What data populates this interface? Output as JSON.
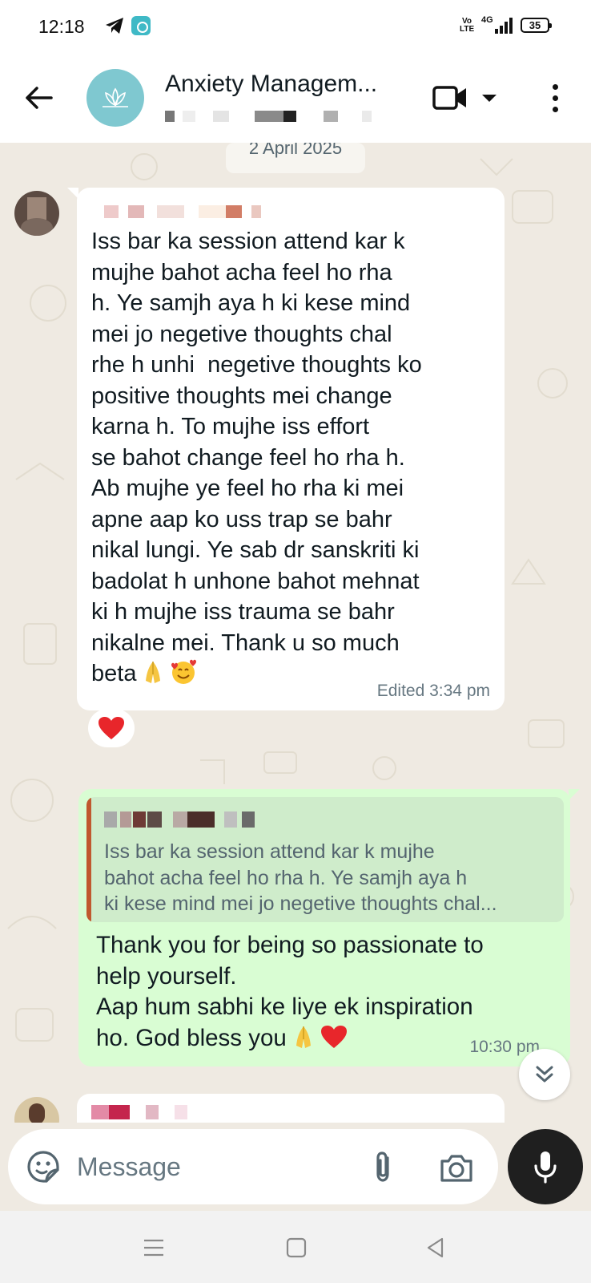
{
  "status_bar": {
    "time": "12:18",
    "volte": "Vo\nLTE",
    "network": "4G",
    "battery": "35",
    "icons": [
      "telegram-icon",
      "app-badge-icon",
      "signal-icon",
      "battery-icon"
    ]
  },
  "header": {
    "title": "Anxiety Managem...",
    "icons": [
      "back-arrow-icon",
      "video-call-icon",
      "chevron-down-icon",
      "more-vert-icon"
    ]
  },
  "chat": {
    "date_chip": "2 April 2025",
    "incoming": {
      "text": "Iss bar ka session attend kar k\nmujhe bahot acha feel ho rha\nh. Ye samjh aya h ki kese mind\nmei jo negetive thoughts chal\nrhe h unhi  negetive thoughts ko\npositive thoughts mei change\nkarna h. To mujhe iss effort\nse bahot change feel ho rha h.\nAb mujhe ye feel ho rha ki mei\napne aap ko uss trap se bahr\nnikal lungi. Ye sab dr sanskriti ki\nbadolat h unhone bahot mehnat\nki h mujhe iss trauma se bahr\nnikalne mei. Thank u so much\nbeta",
      "emojis": [
        "folded-hands-emoji",
        "smiling-face-with-hearts-emoji"
      ],
      "meta": "Edited 3:34 pm",
      "reaction": "red-heart-emoji"
    },
    "outgoing": {
      "quote_lines": [
        "Iss bar ka session attend kar k mujhe",
        "bahot acha feel ho rha h. Ye samjh aya h",
        "ki kese mind mei jo negetive thoughts chal..."
      ],
      "text": "Thank you for being so passionate to\nhelp yourself.\nAap hum sabhi ke liye ek inspiration\nho. God bless you",
      "emojis": [
        "folded-hands-emoji",
        "red-heart-emoji"
      ],
      "meta": "10:30 pm"
    }
  },
  "composer": {
    "placeholder": "Message",
    "icons": [
      "sticker-icon",
      "attach-icon",
      "camera-icon",
      "mic-icon"
    ]
  },
  "colors": {
    "chat_bg": "#efeae2",
    "incoming_bubble": "#ffffff",
    "outgoing_bubble": "#d9fdd3",
    "quote_bar": "#c0582e",
    "meta_text": "#667781"
  }
}
